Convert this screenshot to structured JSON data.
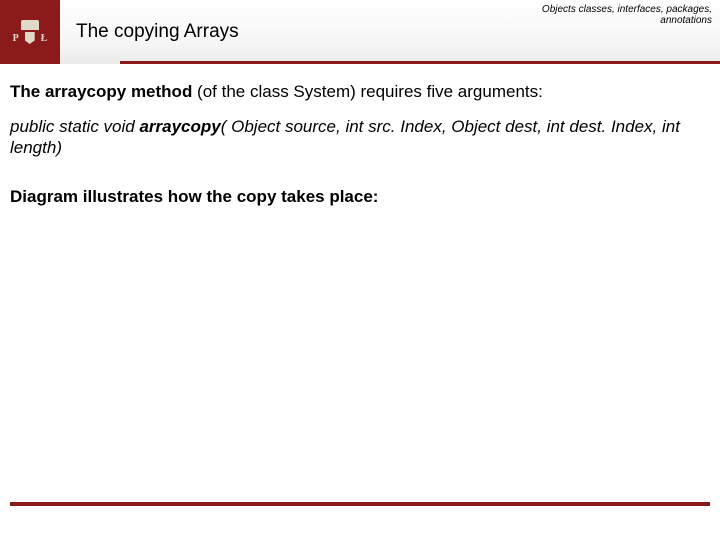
{
  "header": {
    "logo": {
      "left": "P",
      "right": "Ł"
    },
    "title": "The copying Arrays",
    "subtitle_line1": "Objects classes, interfaces, packages,",
    "subtitle_line2": "annotations"
  },
  "body": {
    "intro_bold": "The arraycopy method",
    "intro_rest": " (of the class System) requires five arguments:",
    "sig_prefix": "public static void ",
    "sig_method": "arraycopy",
    "sig_params": "( Object source, int src. Index, Object dest, int dest. Index, int length)",
    "diagram_text": "Diagram illustrates how the copy takes place:"
  },
  "colors": {
    "brand": "#8b1a1a"
  }
}
